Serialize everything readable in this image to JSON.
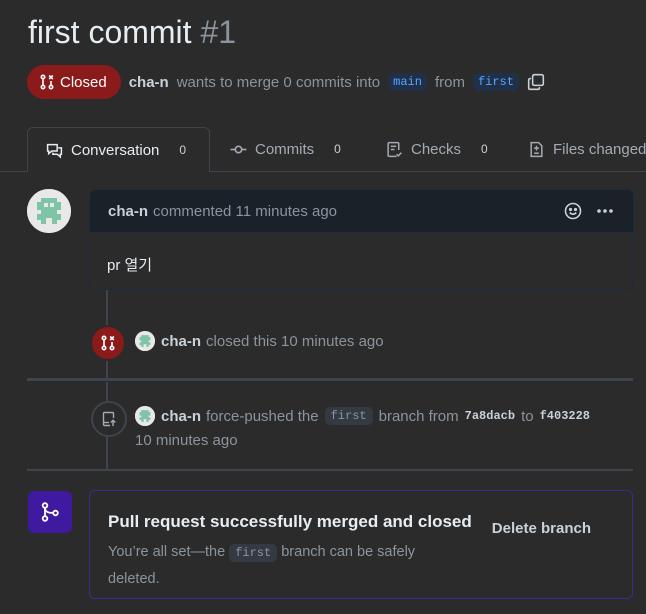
{
  "pr": {
    "title": "first commit",
    "number": "#1",
    "state": "Closed",
    "author": "cha-n",
    "merge_text": "wants to merge 0 commits into",
    "base_branch": "main",
    "from_text": "from",
    "head_branch": "first"
  },
  "tabs": [
    {
      "label": "Conversation",
      "count": "0"
    },
    {
      "label": "Commits",
      "count": "0"
    },
    {
      "label": "Checks",
      "count": "0"
    },
    {
      "label": "Files changed",
      "count": ""
    }
  ],
  "comment": {
    "author": "cha-n",
    "meta": "commented 11 minutes ago",
    "body": "pr 열기"
  },
  "events": {
    "closed": {
      "author": "cha-n",
      "text": "closed this 10 minutes ago"
    },
    "force_push": {
      "author": "cha-n",
      "text1": "force-pushed the",
      "branch": "first",
      "text2": "branch from",
      "from_sha": "7a8dacb",
      "to_text": "to",
      "to_sha": "f403228",
      "time": "10 minutes ago"
    }
  },
  "merge_box": {
    "title": "Pull request successfully merged and closed",
    "desc1": "You’re all set—the",
    "branch": "first",
    "desc2": "branch can be safely deleted.",
    "delete_label": "Delete branch"
  },
  "colors": {
    "closed_badge": "#8b1a1a",
    "merged_purple": "#3f1aa0",
    "link_blue": "#58a6ff"
  },
  "icons": [
    "git-pull-request-closed-icon",
    "copy-icon",
    "comment-discussion-icon",
    "git-commit-icon",
    "checklist-icon",
    "file-diff-icon",
    "smiley-icon",
    "kebab-horizontal-icon",
    "repo-push-icon",
    "git-merge-icon"
  ]
}
